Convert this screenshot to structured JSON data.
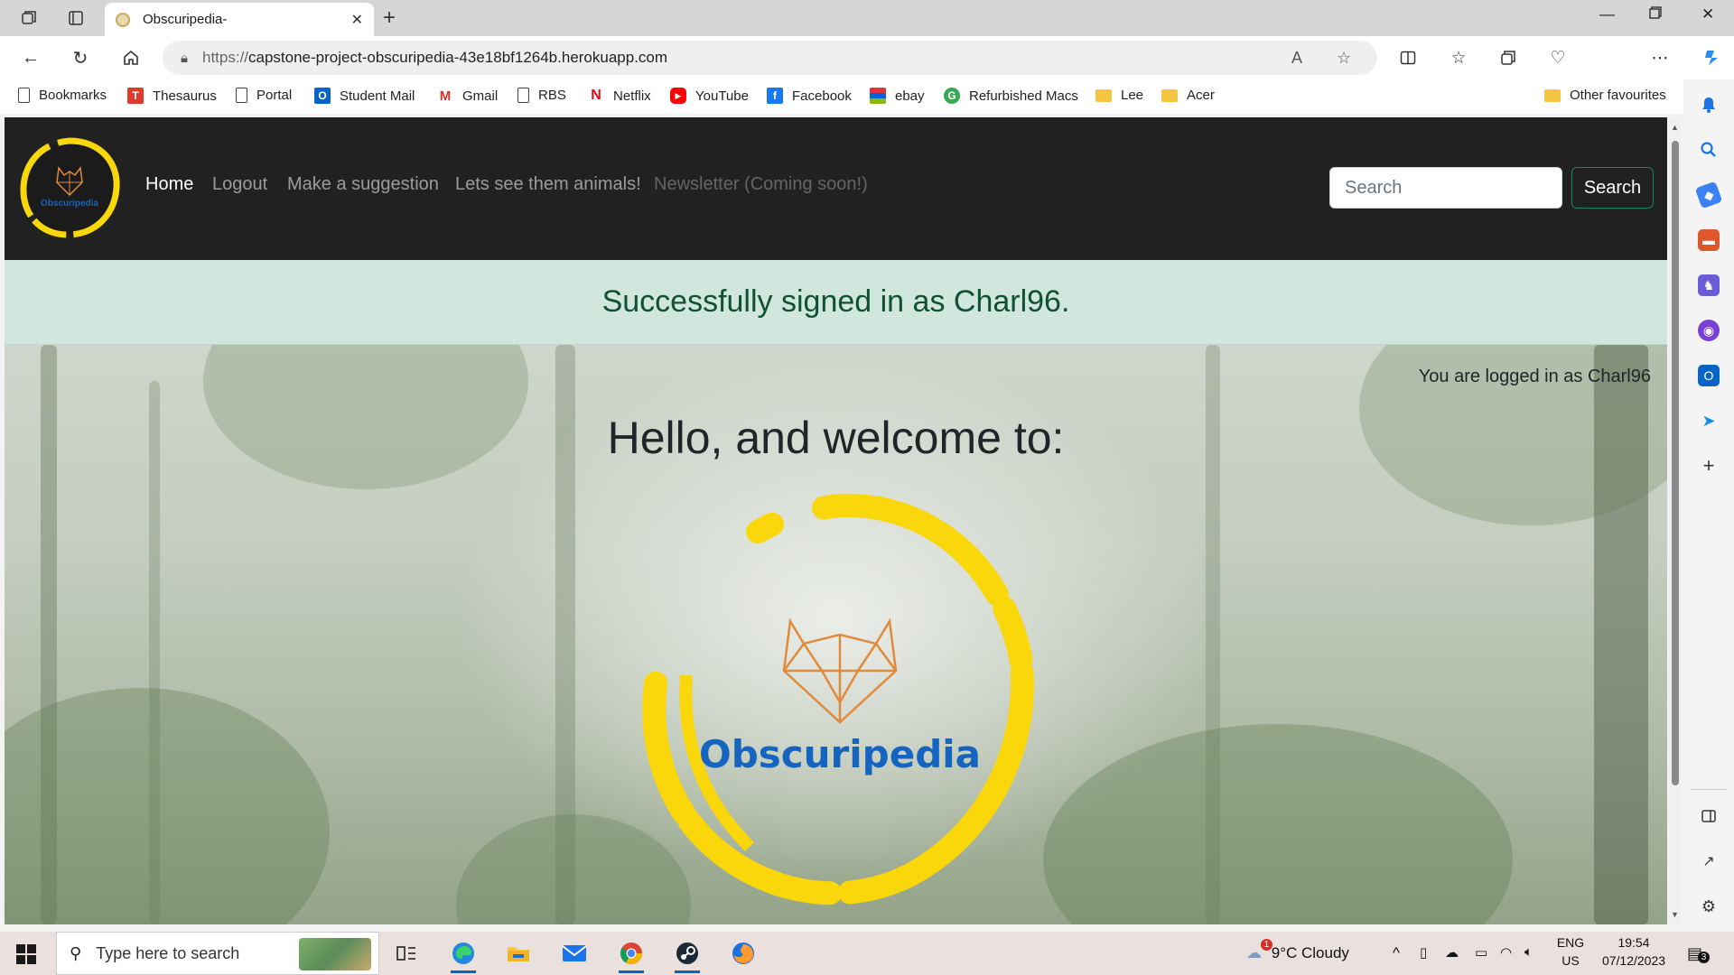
{
  "browser": {
    "tab_title": "Obscuripedia-",
    "url_scheme": "https://",
    "url_host": "capstone-project-obscuripedia-43e18bf1264b.herokuapp.com",
    "bookmarks": [
      {
        "label": "Bookmarks",
        "icon": "page-icon",
        "color": "#ffffff"
      },
      {
        "label": "Thesaurus",
        "icon": "thesaurus-icon",
        "color": "#e03a2b"
      },
      {
        "label": "Portal",
        "icon": "page-icon",
        "color": "#ffffff"
      },
      {
        "label": "Student Mail",
        "icon": "outlook-icon",
        "color": "#0a64c4"
      },
      {
        "label": "Gmail",
        "icon": "gmail-icon",
        "color": "#ffffff"
      },
      {
        "label": "RBS",
        "icon": "page-icon",
        "color": "#ffffff"
      },
      {
        "label": "Netflix",
        "icon": "netflix-icon",
        "color": "#ffffff"
      },
      {
        "label": "YouTube",
        "icon": "youtube-icon",
        "color": "#ff0000"
      },
      {
        "label": "Facebook",
        "icon": "facebook-icon",
        "color": "#1877f2"
      },
      {
        "label": "ebay",
        "icon": "ebay-icon",
        "color": "#ffffff"
      },
      {
        "label": "Refurbished Macs",
        "icon": "refurb-icon",
        "color": "#34a853"
      },
      {
        "label": "Lee",
        "icon": "folder-icon",
        "color": "#f5c542"
      },
      {
        "label": "Acer",
        "icon": "folder-icon",
        "color": "#f5c542"
      }
    ],
    "other_favourites": "Other favourites"
  },
  "site": {
    "logo_text": "Obscuripedia",
    "nav": [
      {
        "label": "Home",
        "state": "active"
      },
      {
        "label": "Logout",
        "state": "normal"
      },
      {
        "label": "Make a suggestion",
        "state": "normal"
      },
      {
        "label": "Lets see them animals!",
        "state": "normal"
      },
      {
        "label": "Newsletter (Coming soon!)",
        "state": "disabled"
      }
    ],
    "search_placeholder": "Search",
    "search_button": "Search",
    "alert_message": "Successfully signed in as Charl96.",
    "logged_in_text": "You are logged in as Charl96",
    "welcome_heading": "Hello, and welcome to:",
    "hero_logo_text": "Obscuripedia",
    "colors": {
      "navbar": "#212121",
      "alert_bg": "#d1e7dd",
      "alert_text": "#0f5132",
      "brand_yellow": "#f9d70b",
      "brand_blue": "#1565c0",
      "fox_orange": "#e08a3c"
    }
  },
  "taskbar": {
    "search_placeholder": "Type here to search",
    "weather": "9°C  Cloudy",
    "weather_badge": "1",
    "lang_top": "ENG",
    "lang_bottom": "US",
    "time": "19:54",
    "date": "07/12/2023",
    "notification_count": "3"
  }
}
